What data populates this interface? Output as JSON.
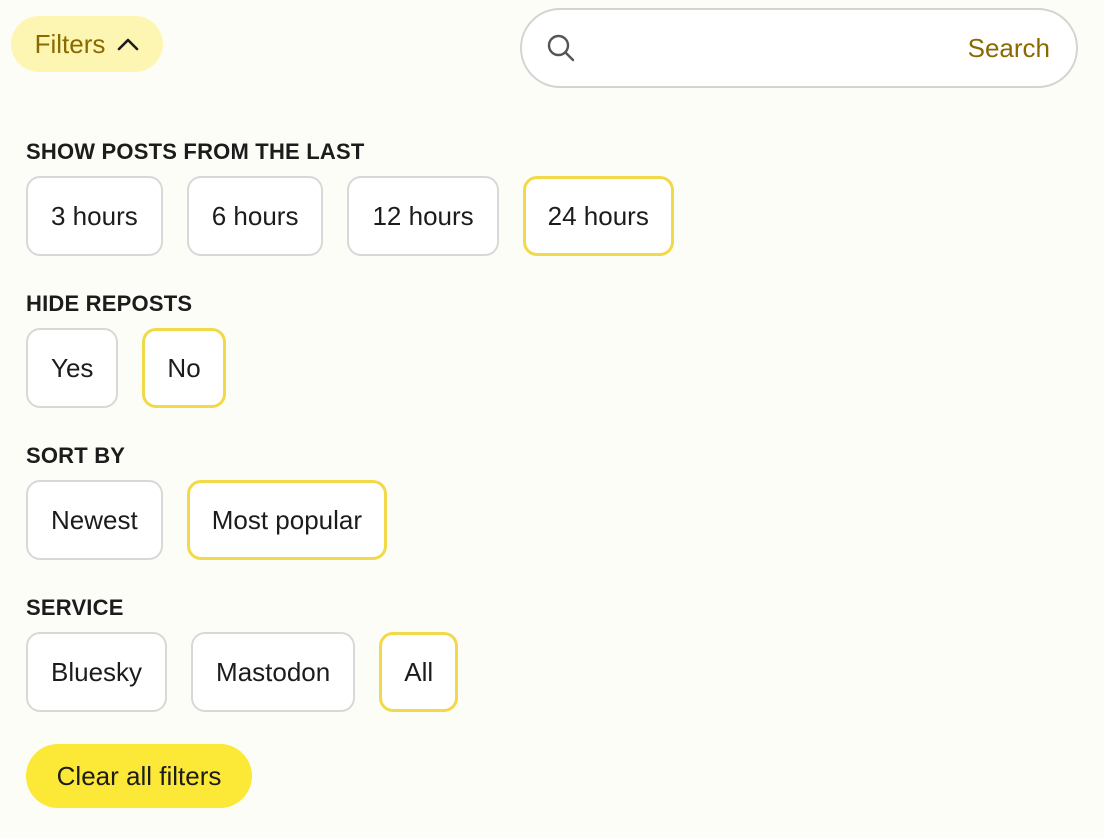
{
  "filters_toggle": {
    "label": "Filters",
    "icon": "chevron-up-icon"
  },
  "search": {
    "placeholder": "Search",
    "value": "",
    "icon": "search-icon"
  },
  "sections": {
    "time": {
      "label": "SHOW POSTS FROM THE LAST",
      "options": [
        "3 hours",
        "6 hours",
        "12 hours",
        "24 hours"
      ],
      "selected": "24 hours"
    },
    "reposts": {
      "label": "HIDE REPOSTS",
      "options": [
        "Yes",
        "No"
      ],
      "selected": "No"
    },
    "sort": {
      "label": "SORT BY",
      "options": [
        "Newest",
        "Most popular"
      ],
      "selected": "Most popular"
    },
    "service": {
      "label": "SERVICE",
      "options": [
        "Bluesky",
        "Mastodon",
        "All"
      ],
      "selected": "All"
    }
  },
  "clear_button": {
    "label": "Clear all filters"
  },
  "colors": {
    "background": "#fdfdf7",
    "accent_yellow": "#fce837",
    "toggle_bg": "#fdf6b2",
    "toggle_text": "#8a6a00",
    "selected_border": "#f2d94a",
    "chip_border": "#d8d8d8"
  }
}
